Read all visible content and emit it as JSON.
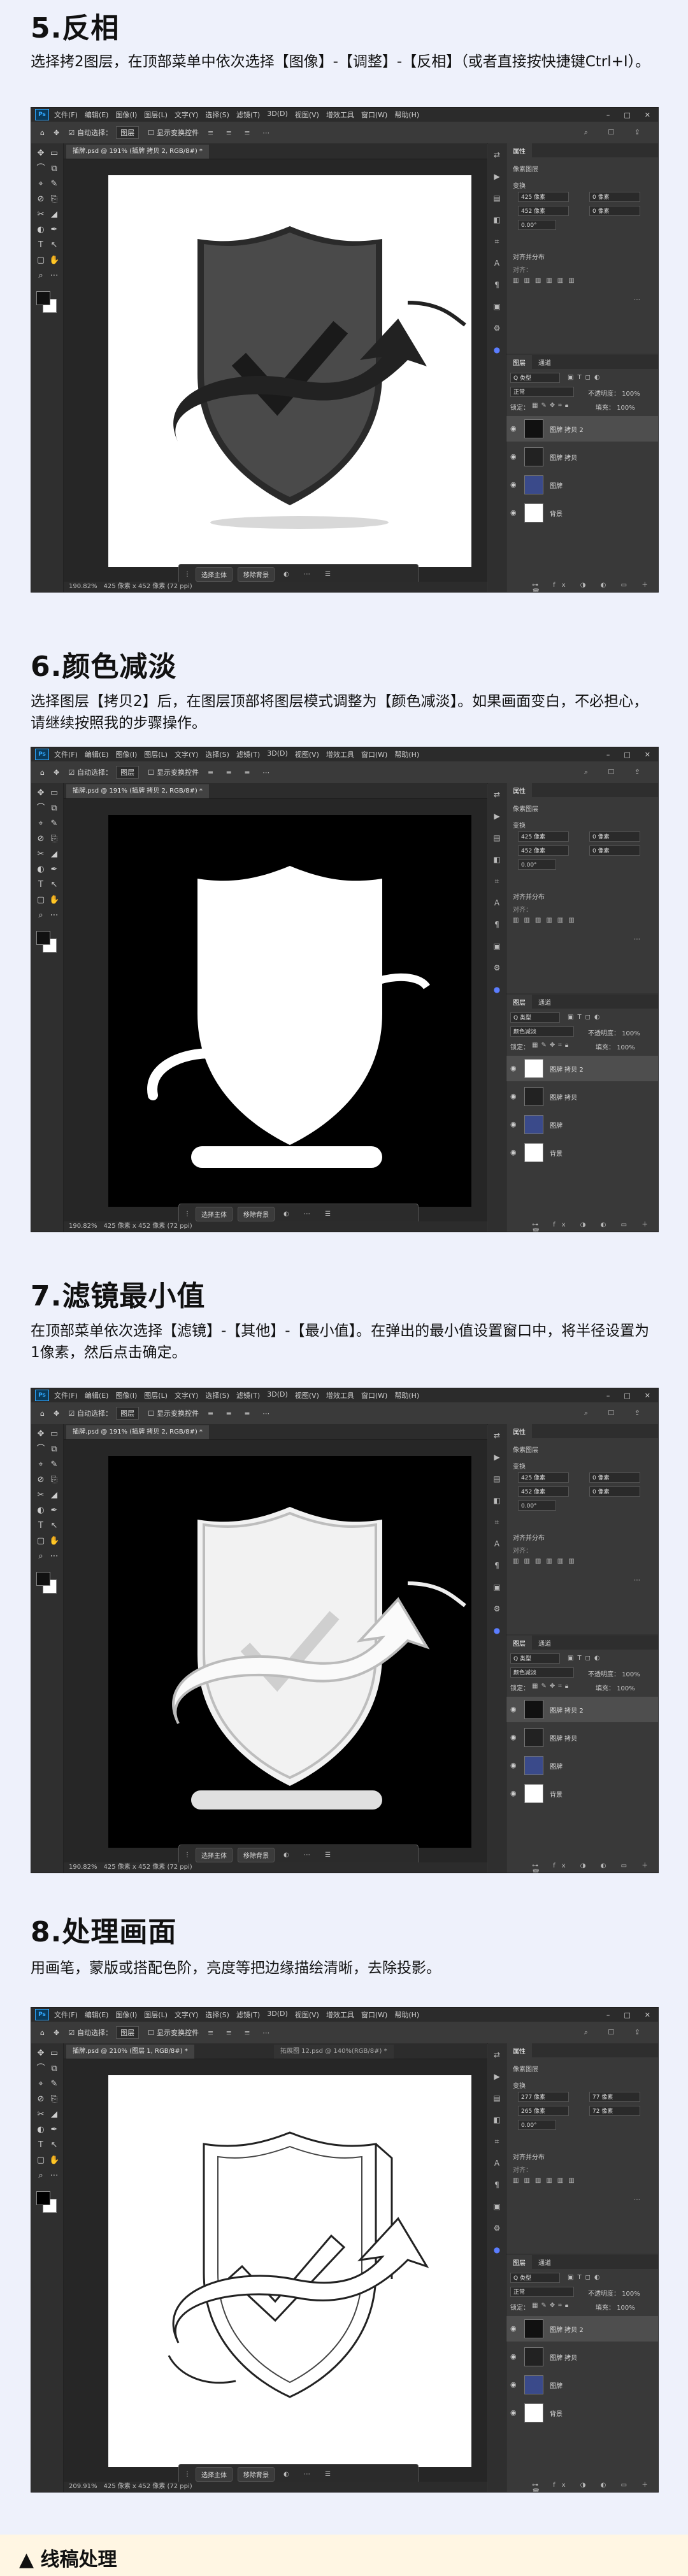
{
  "steps": [
    {
      "title": "5.反相",
      "desc": "选择拷2图层，在顶部菜单中依次选择【图像】-【调整】-【反相】（或者直接按快捷键Ctrl+I）。",
      "canvas_mode": "invert-color",
      "doc_tab": "插牌.psd @ 191% (插牌 拷贝 2, RGB/8#) *",
      "status": "190.82%　425 像素 x 452 像素 (72 ppi)",
      "blend_mode": "正常",
      "transform": {
        "w": "425 像素",
        "h": "452 像素",
        "x": "0 像素",
        "y": "0 像素",
        "angle": "0.00°"
      }
    },
    {
      "title": "6.颜色减淡",
      "desc": "选择图层【拷贝2】后，在图层顶部将图层模式调整为【颜色减淡】。如果画面变白，不必担心，请继续按照我的步骤操作。",
      "canvas_mode": "white-on-black",
      "doc_tab": "插牌.psd @ 191% (插牌 拷贝 2, RGB/8#) *",
      "status": "190.82%　425 像素 x 452 像素 (72 ppi)",
      "blend_mode": "颜色减淡",
      "transform": {
        "w": "425 像素",
        "h": "452 像素",
        "x": "0 像素",
        "y": "0 像素",
        "angle": "0.00°"
      }
    },
    {
      "title": "7.滤镜最小值",
      "desc": "在顶部菜单依次选择【滤镜】-【其他】-【最小值】。在弹出的最小值设置窗口中，将半径设置为1像素，然后点击确定。",
      "canvas_mode": "outline-on-black",
      "doc_tab": "插牌.psd @ 191% (插牌 拷贝 2, RGB/8#) *",
      "status": "190.82%　425 像素 x 452 像素 (72 ppi)",
      "blend_mode": "颜色减淡",
      "transform": {
        "w": "425 像素",
        "h": "452 像素",
        "x": "0 像素",
        "y": "0 像素",
        "angle": "0.00°"
      }
    },
    {
      "title": "8.处理画面",
      "desc": "用画笔，蒙版或搭配色阶，亮度等把边缘描绘清晰，去除投影。",
      "canvas_mode": "line-art",
      "doc_tab": "插牌.psd @ 210% (图层 1, RGB/8#) *",
      "doc_tab2": "拓展图 12.psd @ 140%(RGB/8#) *",
      "status": "209.91%　425 像素 x 452 像素 (72 ppi)",
      "blend_mode": "正常",
      "transform": {
        "w": "277 像素",
        "h": "265 像素",
        "x": "77 像素",
        "y": "72 像素",
        "angle": "0.00°"
      }
    }
  ],
  "ui": {
    "logo": "Ps",
    "menu": [
      "文件(F)",
      "编辑(E)",
      "图像(I)",
      "图层(L)",
      "文字(Y)",
      "选择(S)",
      "滤镜(T)",
      "3D(D)",
      "视图(V)",
      "增效工具",
      "窗口(W)",
      "帮助(H)"
    ],
    "win_controls": [
      "–",
      "□",
      "✕"
    ],
    "opt_auto_select": "自动选择：",
    "opt_layer_box": "图层",
    "opt_show_transform": "显示变换控件",
    "ctx_select_subject": "选择主体",
    "ctx_remove_bg": "移除背景",
    "props_tab": "属性",
    "props_pixel_layer": "像素图层",
    "props_transform": "变换",
    "props_align": "对齐并分布",
    "props_align_sub": "对齐：",
    "layers_tab": "图层",
    "channels_tab": "通道",
    "kind_filter": "Q 类型",
    "opacity_label": "不透明度：",
    "opacity_value": "100%",
    "lock_label": "锁定：",
    "fill_label": "填充：",
    "fill_value": "100%",
    "layers": [
      "图牌 拷贝 2",
      "图牌 拷贝",
      "图牌",
      "背景"
    ]
  },
  "caption": "▲ 线稿处理"
}
